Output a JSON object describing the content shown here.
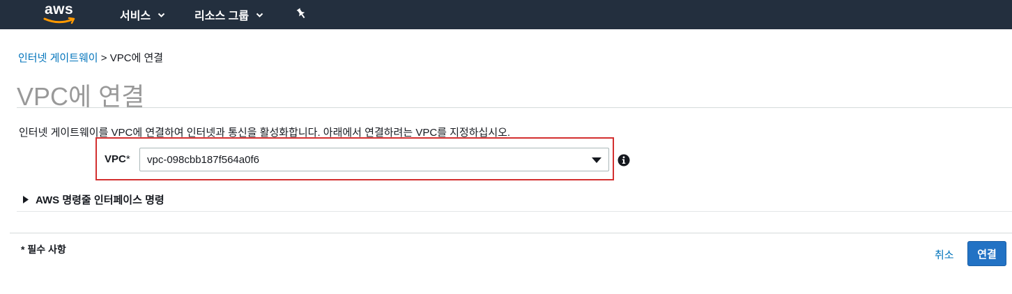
{
  "topbar": {
    "logo_text": "aws",
    "nav": [
      {
        "label": "서비스"
      },
      {
        "label": "리소스 그룹"
      }
    ]
  },
  "breadcrumb": {
    "parent": "인터넷 게이트웨이",
    "separator": " > ",
    "current": "VPC에 연결"
  },
  "page": {
    "title": "VPC에 연결",
    "description": "인터넷 게이트웨이를 VPC에 연결하여 인터넷과 통신을 활성화합니다. 아래에서 연결하려는 VPC를 지정하십시오."
  },
  "form": {
    "vpc_label": "VPC",
    "required_mark": "*",
    "vpc_value": "vpc-098cbb187f564a0f6"
  },
  "cli": {
    "label": "AWS 명령줄 인터페이스 명령"
  },
  "footer": {
    "required_note": "* 필수 사항",
    "cancel_label": "취소",
    "connect_label": "연결"
  },
  "colors": {
    "topbar": "#232f3e",
    "link": "#0073bb",
    "primary_button": "#2272c4",
    "highlight_box": "#d32f2f"
  },
  "icons": [
    "aws-logo",
    "chevron-down-icon",
    "pin-icon",
    "caret-down-icon",
    "info-icon",
    "expand-triangle-icon"
  ]
}
